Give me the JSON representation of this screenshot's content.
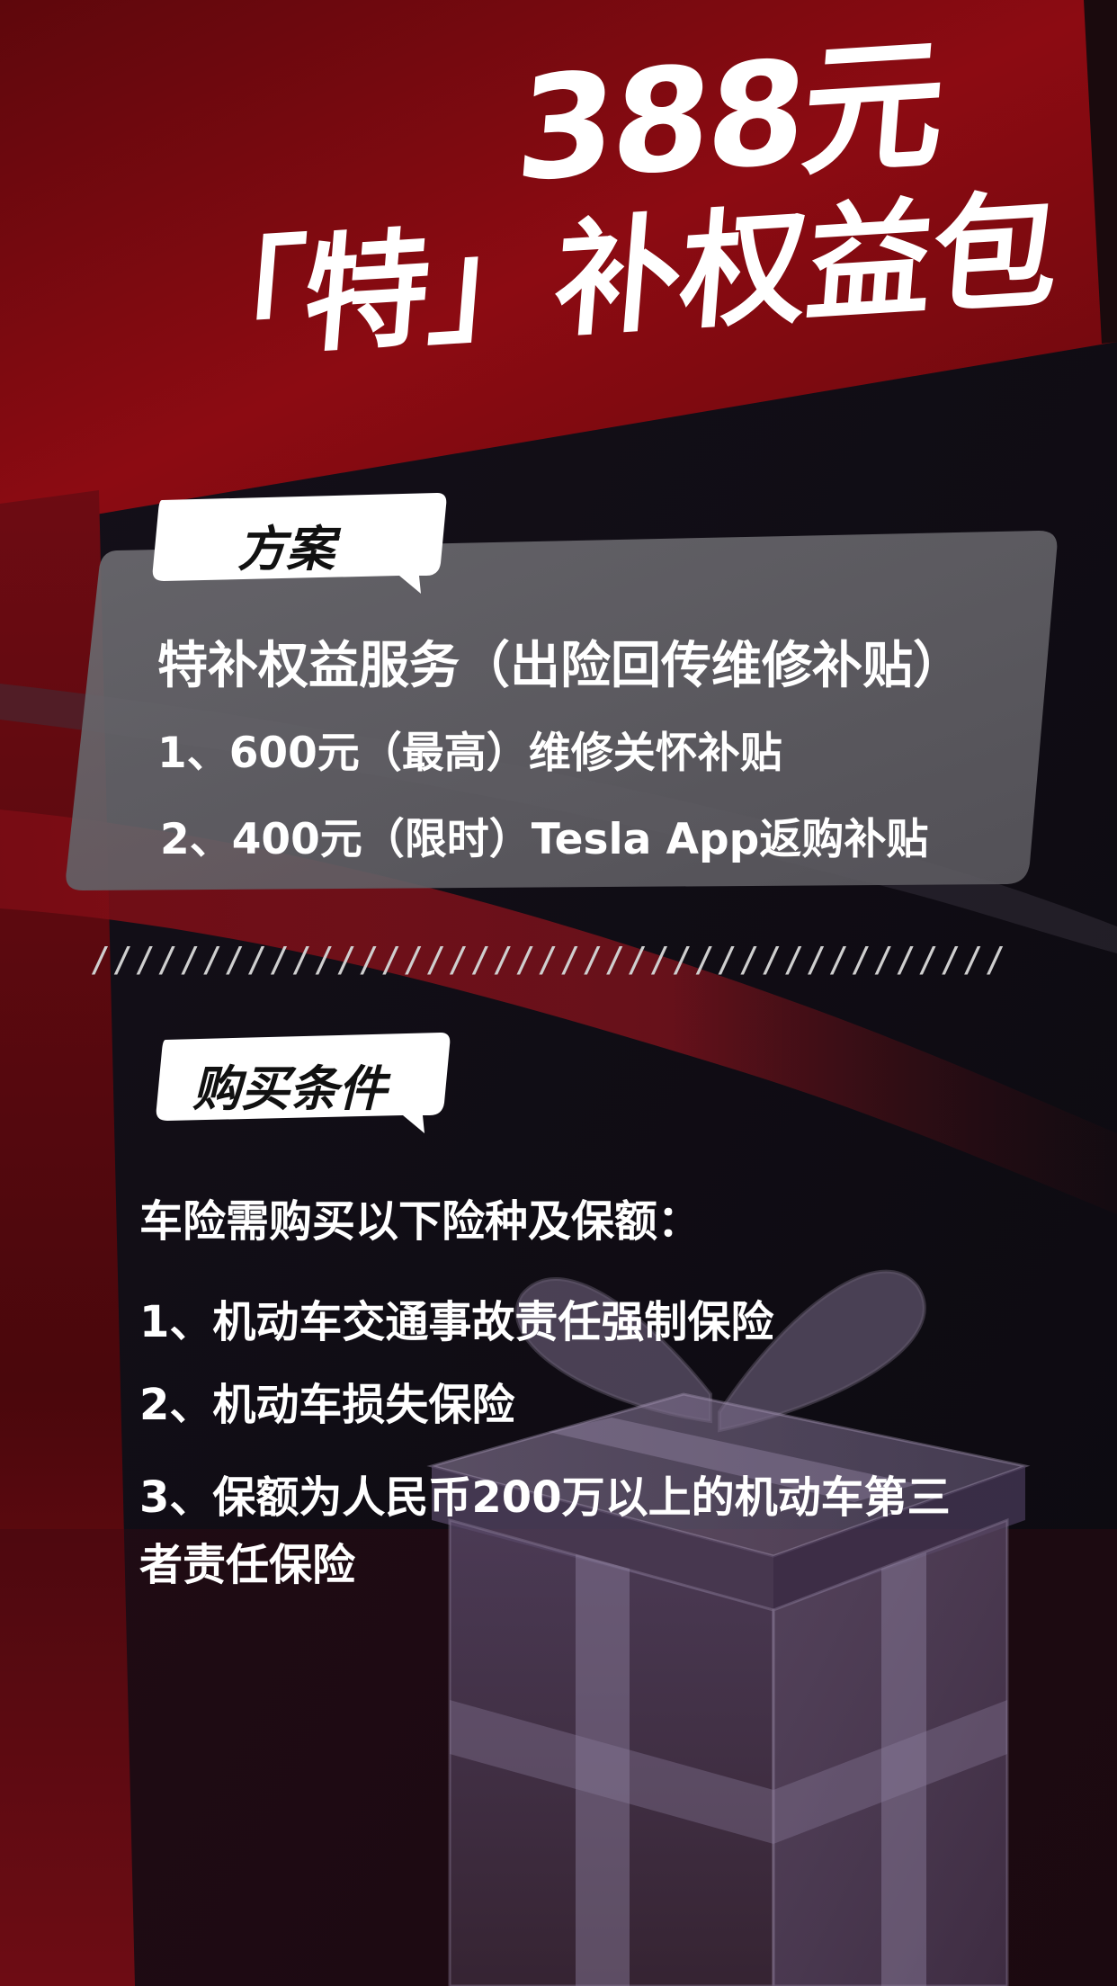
{
  "headline": {
    "price": "388元",
    "title": "「特」补权益包"
  },
  "plan": {
    "tag": "方案",
    "title": "特补权益服务（出险回传维修补贴）",
    "items": [
      "1、600元（最高）维修关怀补贴",
      "2、400元（限时）Tesla  App返购补贴"
    ]
  },
  "divider": "//////////////////////////////////////////////////////////",
  "conditions": {
    "tag": "购买条件",
    "intro": "车险需购买以下险种及保额：",
    "items": [
      "1、机动车交通事故责任强制保险",
      "2、机动车损失保险",
      "3、保额为人民币200万以上的机动车第三",
      "者责任保险"
    ]
  },
  "colors": {
    "brand_red": "#7a0a10",
    "card_gray": "#6a6a6e",
    "text": "#ffffff"
  },
  "icons": [
    "gift-box-icon"
  ]
}
